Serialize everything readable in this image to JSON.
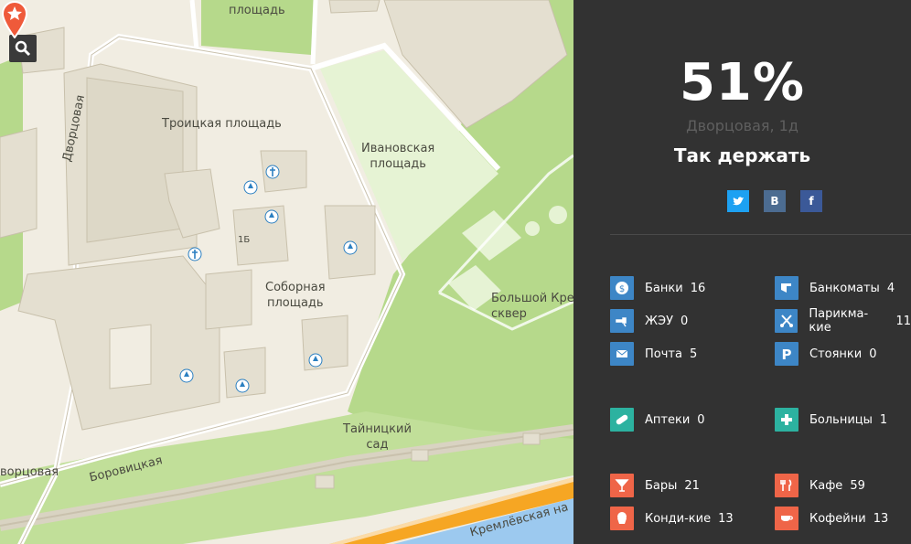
{
  "map": {
    "search_button_icon": "search-icon",
    "labels": {
      "top_square": "площадь",
      "trinity_square": "Троицкая площадь",
      "ivanovskaya": "Ивановская\nплощадь",
      "cathedral_square": "Соборная\nплощадь",
      "dvortsovaya_street": "Дворцовая",
      "dvortsovaya_street_2": "ворцовая",
      "borovitskaya": "Боровицкая",
      "tainitsky": "Тайницкий\nсад",
      "big_kremlin_square": "Большой Кремл\nсквер",
      "kremlevskaya": "Кремлёвская на",
      "building_1b": "1Б"
    }
  },
  "panel": {
    "percent": "51%",
    "address": "Дворцовая, 1д",
    "motto": "Так держать",
    "social": [
      {
        "label": "twitter-icon",
        "color": "#1da1f2",
        "glyph": "t"
      },
      {
        "label": "vk-icon",
        "color": "#4c6c91",
        "glyph": "B"
      },
      {
        "label": "facebook-icon",
        "color": "#3b5998",
        "glyph": "f"
      }
    ],
    "categories": [
      {
        "name": "Банки",
        "count": "16",
        "icon": "bank-icon",
        "color": "#3d86c6"
      },
      {
        "name": "Банкоматы",
        "count": "4",
        "icon": "atm-icon",
        "color": "#3d86c6"
      },
      {
        "name": "ЖЭУ",
        "count": "0",
        "icon": "housing-office-icon",
        "color": "#3d86c6"
      },
      {
        "name": "Парикма-кие",
        "count": "11",
        "icon": "scissors-icon",
        "color": "#3d86c6"
      },
      {
        "name": "Почта",
        "count": "5",
        "icon": "mail-icon",
        "color": "#3d86c6"
      },
      {
        "name": "Стоянки",
        "count": "0",
        "icon": "parking-icon",
        "color": "#3d86c6"
      },
      {
        "name": "Аптеки",
        "count": "0",
        "icon": "pill-icon",
        "color": "#2cb2a0"
      },
      {
        "name": "Больницы",
        "count": "1",
        "icon": "hospital-cross-icon",
        "color": "#2cb2a0"
      },
      {
        "name": "Бары",
        "count": "21",
        "icon": "cocktail-icon",
        "color": "#ef6548"
      },
      {
        "name": "Кафе",
        "count": "59",
        "icon": "fork-knife-icon",
        "color": "#ef6548"
      },
      {
        "name": "Конди-кие",
        "count": "13",
        "icon": "cupcake-icon",
        "color": "#ef6548"
      },
      {
        "name": "Кофейни",
        "count": "13",
        "icon": "coffee-cup-icon",
        "color": "#ef6548"
      }
    ]
  }
}
